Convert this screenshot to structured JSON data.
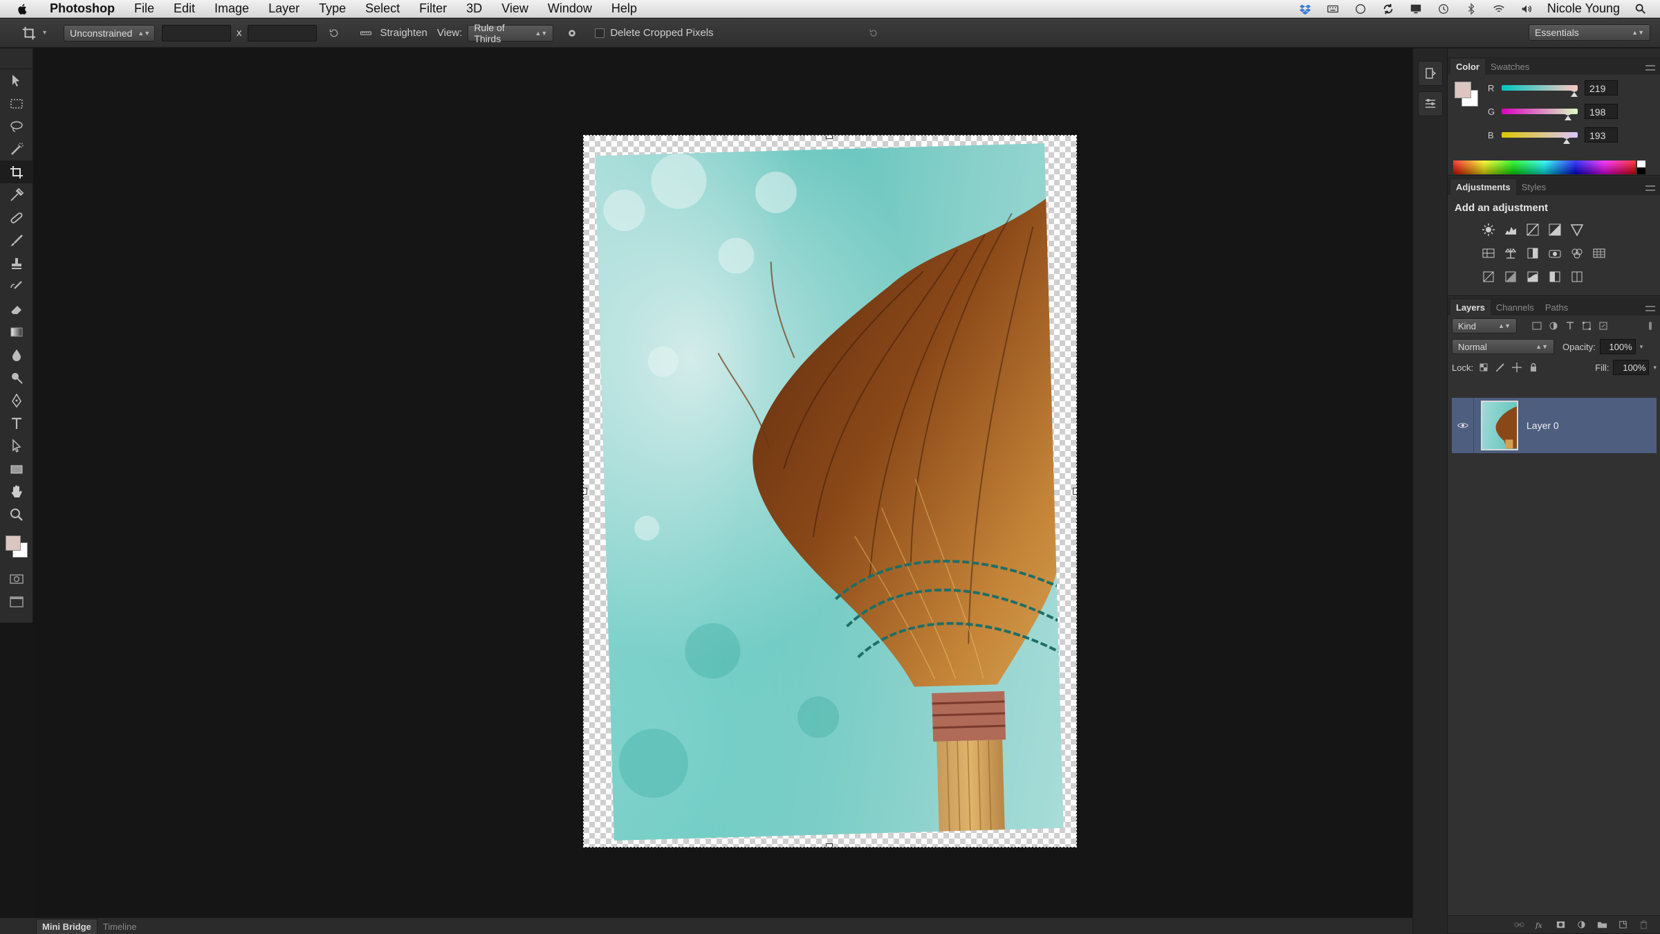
{
  "menubar": {
    "app_name": "Photoshop",
    "items": [
      "File",
      "Edit",
      "Image",
      "Layer",
      "Type",
      "Select",
      "Filter",
      "3D",
      "View",
      "Window",
      "Help"
    ],
    "user": "Nicole Young"
  },
  "options_bar": {
    "ratio_preset": "Unconstrained",
    "width_value": "",
    "separator": "x",
    "height_value": "",
    "straighten_label": "Straighten",
    "view_label": "View:",
    "view_value": "Rule of Thirds",
    "delete_cropped_label": "Delete Cropped Pixels",
    "delete_cropped_checked": false,
    "workspace": "Essentials"
  },
  "toolbar": {
    "tools": [
      "move-tool",
      "rectangular-marquee-tool",
      "lasso-tool",
      "quick-selection-tool",
      "crop-tool",
      "eyedropper-tool",
      "spot-healing-tool",
      "brush-tool",
      "clone-stamp-tool",
      "history-brush-tool",
      "eraser-tool",
      "gradient-tool",
      "blur-tool",
      "dodge-tool",
      "pen-tool",
      "type-tool",
      "path-selection-tool",
      "rectangle-tool",
      "hand-tool",
      "zoom-tool"
    ],
    "active_tool": "crop-tool",
    "foreground_color": "#dbc6c1",
    "background_color": "#ffffff"
  },
  "bottom_tabs": [
    "Mini Bridge",
    "Timeline"
  ],
  "color_panel": {
    "tabs": [
      "Color",
      "Swatches"
    ],
    "r_label": "R",
    "r_value": "219",
    "g_label": "G",
    "g_value": "198",
    "b_label": "B",
    "b_value": "193"
  },
  "adjustments_panel": {
    "tabs": [
      "Adjustments",
      "Styles"
    ],
    "title": "Add an adjustment"
  },
  "layers_panel": {
    "tabs": [
      "Layers",
      "Channels",
      "Paths"
    ],
    "filter_kind": "Kind",
    "blend_mode": "Normal",
    "opacity_label": "Opacity:",
    "opacity_value": "100%",
    "lock_label": "Lock:",
    "fill_label": "Fill:",
    "fill_value": "100%",
    "layers": [
      {
        "name": "Layer 0",
        "visible": true,
        "selected": true
      }
    ]
  }
}
